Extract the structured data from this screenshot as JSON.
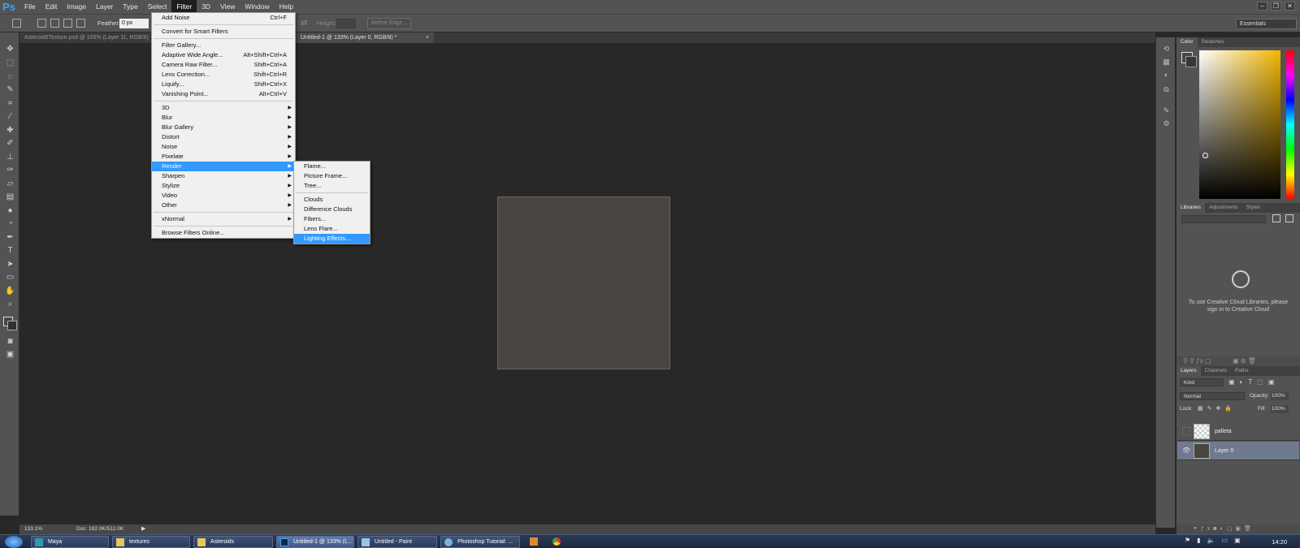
{
  "app": {
    "logo": "Ps"
  },
  "menubar": {
    "items": [
      "File",
      "Edit",
      "Image",
      "Layer",
      "Type",
      "Select",
      "Filter",
      "3D",
      "View",
      "Window",
      "Help"
    ]
  },
  "options": {
    "feather_label": "Feather:",
    "feather_value": "0 px",
    "height_label": "Height:",
    "refine_edge": "Refine Edge...",
    "workspace": "Essentials"
  },
  "tabs": [
    "Asteroid6Texture.psd @ 105% (Layer 11, RGB/8)",
    "Untitled-1 @ 133% (Layer 0, RGB/8) *"
  ],
  "status": {
    "zoom": "133.1%",
    "doc": "Doc: 192.0K/512.0K"
  },
  "filter_menu": {
    "group1": [
      {
        "label": "Add Noise",
        "shortcut": "Ctrl+F"
      }
    ],
    "group2": [
      {
        "label": "Convert for Smart Filters"
      }
    ],
    "group3": [
      {
        "label": "Filter Gallery..."
      },
      {
        "label": "Adaptive Wide Angle...",
        "shortcut": "Alt+Shift+Ctrl+A"
      },
      {
        "label": "Camera Raw Filter...",
        "shortcut": "Shift+Ctrl+A"
      },
      {
        "label": "Lens Correction...",
        "shortcut": "Shift+Ctrl+R"
      },
      {
        "label": "Liquify...",
        "shortcut": "Shift+Ctrl+X"
      },
      {
        "label": "Vanishing Point...",
        "shortcut": "Alt+Ctrl+V"
      }
    ],
    "group4": [
      "3D",
      "Blur",
      "Blur Gallery",
      "Distort",
      "Noise",
      "Pixelate",
      "Render",
      "Sharpen",
      "Stylize",
      "Video",
      "Other"
    ],
    "group5": [
      "xNormal"
    ],
    "group6": [
      "Browse Filters Online..."
    ]
  },
  "render_menu": {
    "group1": [
      "Flame...",
      "Picture Frame...",
      "Tree..."
    ],
    "group2": [
      "Clouds",
      "Difference Clouds",
      "Fibers...",
      "Lens Flare...",
      "Lighting Effects..."
    ]
  },
  "panels": {
    "color_tabs": [
      "Color",
      "Swatches"
    ],
    "lib_tabs": [
      "Libraries",
      "Adjustments",
      "Styles"
    ],
    "lib_message": "To use Creative Cloud Libraries, please sign in to Creative Cloud",
    "layer_tabs": [
      "Layers",
      "Channels",
      "Paths"
    ],
    "kind": "Kind",
    "blend_mode": "Normal",
    "opacity_label": "Opacity:",
    "opacity": "100%",
    "lock_label": "Lock:",
    "fill_label": "Fill:",
    "fill": "100%",
    "layers": [
      {
        "name": "palleta",
        "visible": false
      },
      {
        "name": "Layer 0",
        "visible": true,
        "selected": true
      }
    ]
  },
  "taskbar": {
    "items": [
      "Maya",
      "textures",
      "Asteroids",
      "Untitled-1 @ 133% (L...",
      "Untitled - Paint",
      "Photoshop Tutorial: ..."
    ],
    "clock": "14:20"
  },
  "colors": {
    "highlight": "#3399ff",
    "canvas": "#4a4540",
    "ui": "#535353"
  }
}
